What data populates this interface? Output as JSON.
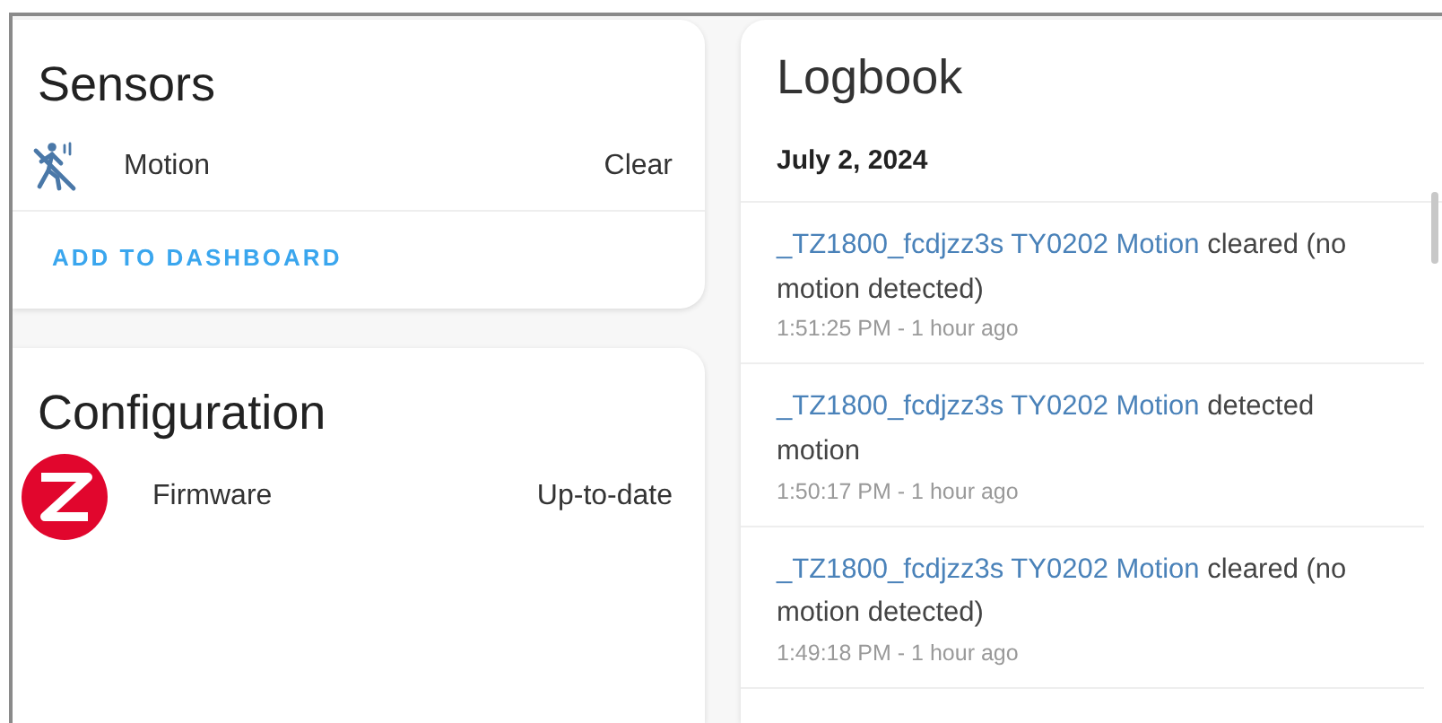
{
  "sensors": {
    "title": "Sensors",
    "rows": [
      {
        "name": "Motion",
        "value": "Clear"
      }
    ],
    "action": "ADD TO DASHBOARD"
  },
  "configuration": {
    "title": "Configuration",
    "rows": [
      {
        "name": "Firmware",
        "value": "Up-to-date"
      }
    ]
  },
  "logbook": {
    "title": "Logbook",
    "date": "July 2, 2024",
    "entries": [
      {
        "entity": "_TZ1800_fcdjzz3s TY0202 Motion",
        "message": "cleared (no motion detected)",
        "time": "1:51:25 PM - 1 hour ago"
      },
      {
        "entity": "_TZ1800_fcdjzz3s TY0202 Motion",
        "message": "detected motion",
        "time": "1:50:17 PM - 1 hour ago"
      },
      {
        "entity": "_TZ1800_fcdjzz3s TY0202 Motion",
        "message": "cleared (no motion detected)",
        "time": "1:49:18 PM - 1 hour ago"
      }
    ]
  }
}
